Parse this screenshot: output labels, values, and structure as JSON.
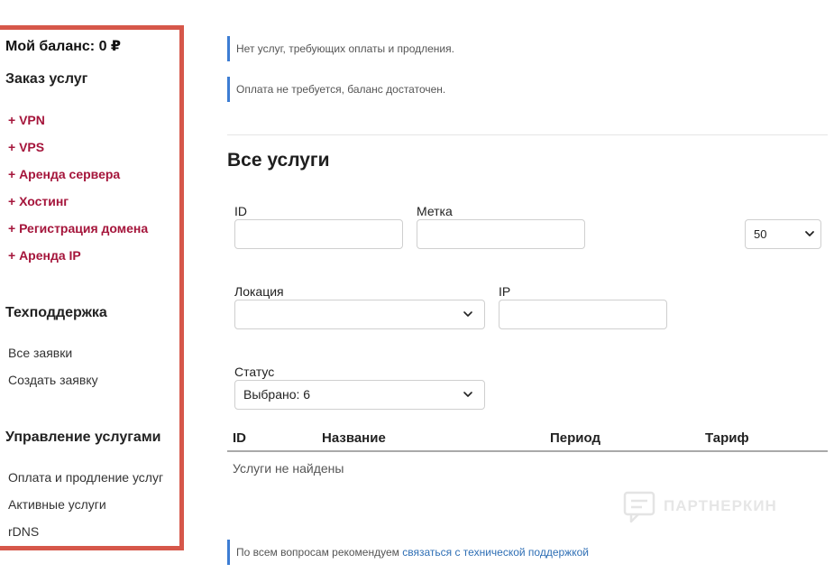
{
  "sidebar": {
    "balance": "Мой баланс: 0 ₽",
    "order_heading": "Заказ услуг",
    "order_items": [
      "+ VPN",
      "+ VPS",
      "+ Аренда сервера",
      "+ Хостинг",
      "+ Регистрация домена",
      "+ Аренда IP"
    ],
    "support_heading": "Техподдержка",
    "support_items": [
      "Все заявки",
      "Создать заявку"
    ],
    "manage_heading": "Управление услугами",
    "manage_items": [
      "Оплата и продление услуг",
      "Активные услуги",
      "rDNS"
    ],
    "border_color": "#d6574a",
    "order_item_color": "#a5153b"
  },
  "notices": {
    "no_payment": "Нет услуг, требующих оплаты и продления.",
    "balance_ok": "Оплата не требуется, баланс достаточен.",
    "support_prefix": "По всем вопросам рекомендуем ",
    "support_link": "связаться с технической поддержкой",
    "accent_color": "#3d7dd3"
  },
  "services": {
    "title": "Все услуги",
    "filters": {
      "id_label": "ID",
      "id_value": "",
      "tag_label": "Метка",
      "tag_value": "",
      "per_page": "50",
      "location_label": "Локация",
      "location_value": "",
      "ip_label": "IP",
      "ip_value": "",
      "status_label": "Статус",
      "status_value": "Выбрано: 6"
    },
    "table": {
      "columns": [
        "ID",
        "Название",
        "Период",
        "Тариф"
      ],
      "empty": "Услуги не найдены"
    }
  },
  "watermark": {
    "text": "ПАРТНЕРКИН",
    "icon": "chat-bubble-icon"
  }
}
